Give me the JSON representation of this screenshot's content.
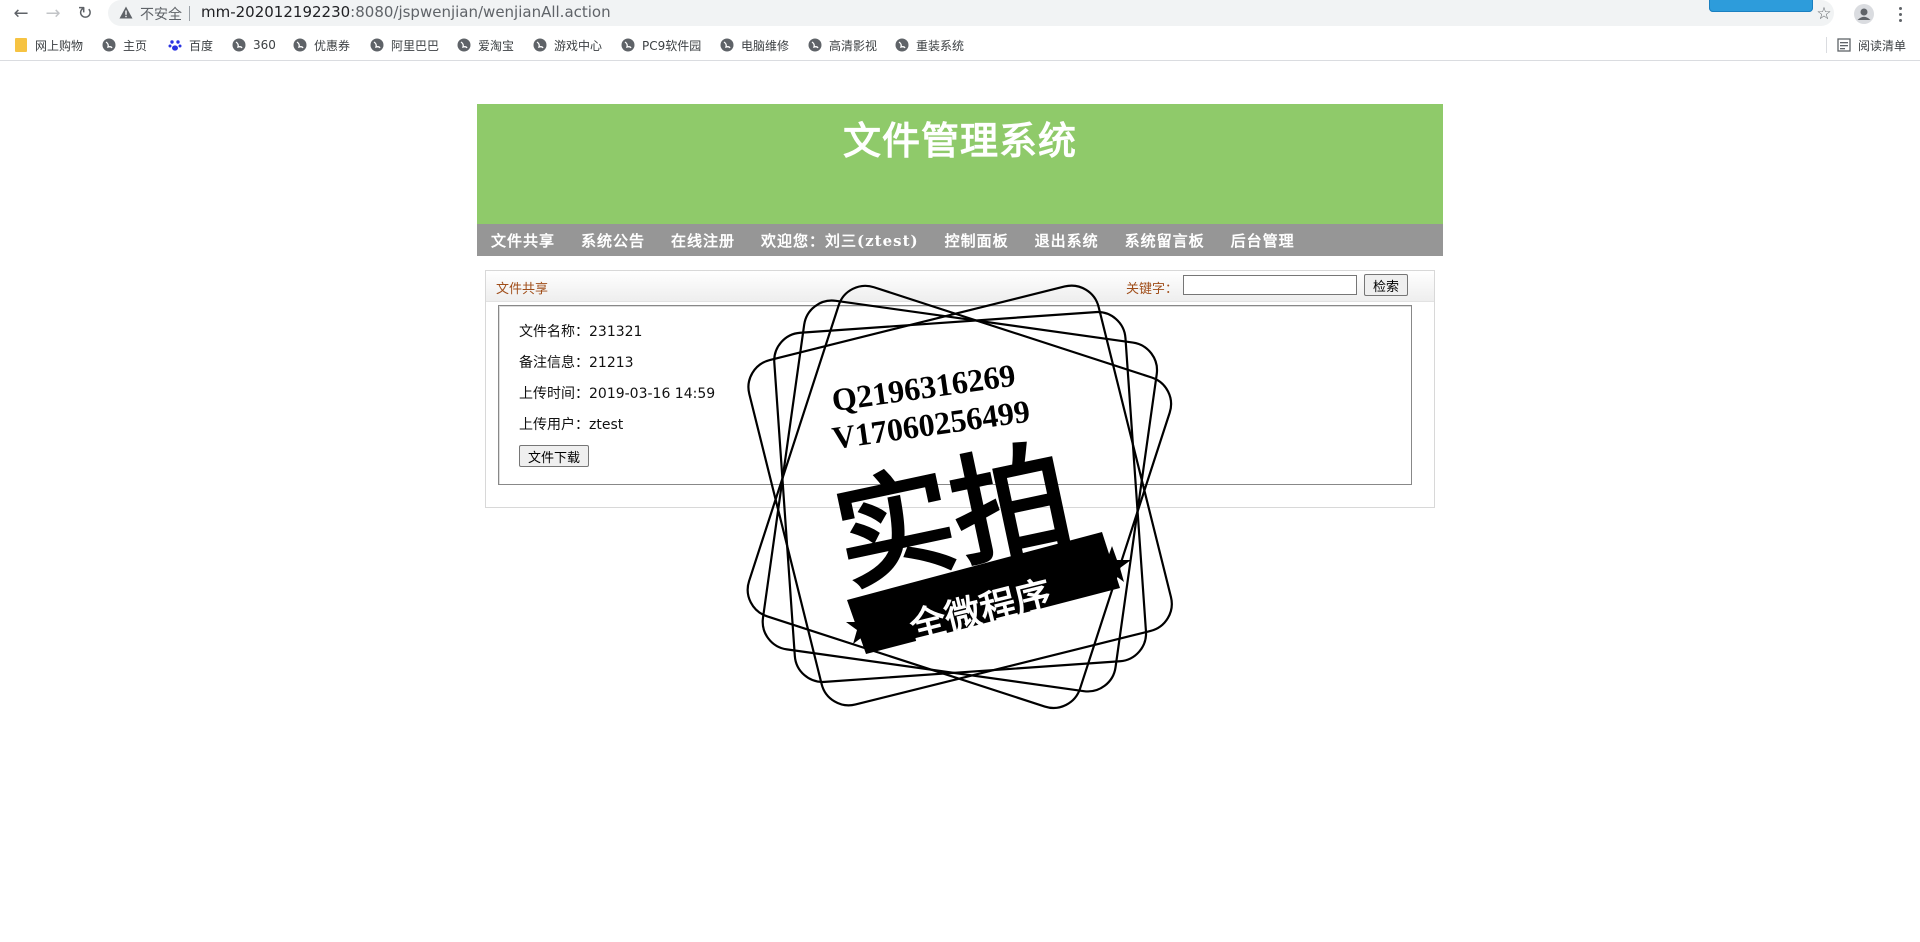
{
  "browser": {
    "insecure_label": "不安全",
    "url_host": "mm-202012192230",
    "url_rest": ":8080/jspwenjian/wenjianAll.action",
    "bookmarks": [
      {
        "label": "网上购物",
        "icon": "folder-icon"
      },
      {
        "label": "主页",
        "icon": "globe-icon"
      },
      {
        "label": "百度",
        "icon": "paw-icon"
      },
      {
        "label": "360",
        "icon": "globe-icon"
      },
      {
        "label": "优惠券",
        "icon": "globe-icon"
      },
      {
        "label": "阿里巴巴",
        "icon": "globe-icon"
      },
      {
        "label": "爱淘宝",
        "icon": "globe-icon"
      },
      {
        "label": "游戏中心",
        "icon": "globe-icon"
      },
      {
        "label": "PC9软件园",
        "icon": "globe-icon"
      },
      {
        "label": "电脑维修",
        "icon": "globe-icon"
      },
      {
        "label": "高清影视",
        "icon": "globe-icon"
      },
      {
        "label": "重装系统",
        "icon": "globe-icon"
      }
    ],
    "reading_list": "阅读清单"
  },
  "site": {
    "title": "文件管理系统",
    "nav": [
      "文件共享",
      "系统公告",
      "在线注册",
      "欢迎您：刘三(ztest)",
      "控制面板",
      "退出系统",
      "系统留言板",
      "后台管理"
    ]
  },
  "panel": {
    "title": "文件共享",
    "search_label": "关键字：",
    "search_value": "",
    "search_button": "检索",
    "file": {
      "name_line": "文件名称：231321",
      "note_line": "备注信息：21213",
      "time_line": "上传时间：2019-03-16 14:59",
      "user_line": "上传用户：ztest"
    },
    "download_button": "文件下载"
  },
  "watermark": {
    "line1": "Q2196316269",
    "line2": "V17060256499",
    "main": "实拍",
    "ribbon": "全微程序"
  }
}
